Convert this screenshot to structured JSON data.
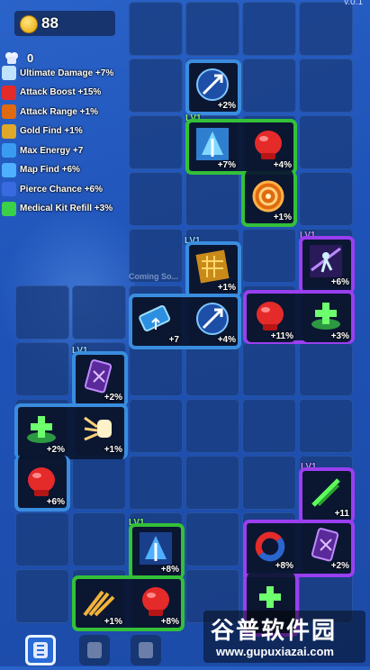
{
  "hud": {
    "version": "v.0.1",
    "coins": "88",
    "bonus_count": "0"
  },
  "stats": [
    {
      "icon": "fist-icon",
      "label": "Ultimate Damage +7%"
    },
    {
      "icon": "boxing-glove-icon",
      "label": "Attack Boost +15%"
    },
    {
      "icon": "target-icon",
      "label": "Attack Range +1%"
    },
    {
      "icon": "gold-icon",
      "label": "Gold Find +1%"
    },
    {
      "icon": "energy-icon",
      "label": "Max Energy +7"
    },
    {
      "icon": "map-icon",
      "label": "Map Find +6%"
    },
    {
      "icon": "pierce-icon",
      "label": "Pierce Chance +6%"
    },
    {
      "icon": "medkit-icon",
      "label": "Medical Kit Refill +3%"
    }
  ],
  "board": {
    "coming_soon": "Coming So..."
  },
  "pieces": {
    "single": {
      "pct": "+2%"
    },
    "green_top": {
      "level": "LV1",
      "cells": [
        "+7%",
        "+4%",
        "+1%"
      ]
    },
    "blue_mid": {
      "level": "LV1",
      "cells": [
        "+1%",
        "+7",
        "+4%"
      ]
    },
    "purple_right": {
      "level": "LV1",
      "cells": [
        "+6%",
        "+11%",
        "+3%"
      ]
    },
    "blue_left": {
      "level": "LV1",
      "cells": [
        "+2%",
        "+2%",
        "+1%",
        "+6%"
      ]
    },
    "purple_bottom": {
      "level": "LV1",
      "cells": [
        "+11",
        "+8%",
        "+2%"
      ]
    },
    "green_bottom": {
      "level": "LV1",
      "cells": [
        "+8%",
        "+1%",
        "+8%"
      ]
    }
  },
  "colors": {
    "green": "#34c038",
    "blue": "#3a8dde",
    "purple": "#9a3ff0"
  },
  "watermark": {
    "line1": "谷普软件园",
    "line2": "www.gupuxiazai.com"
  }
}
